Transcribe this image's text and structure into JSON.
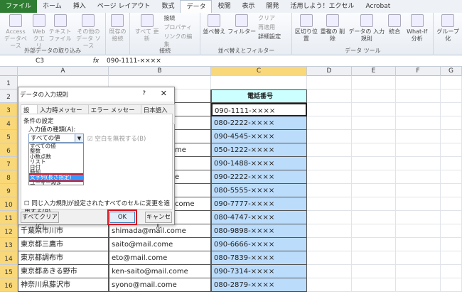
{
  "tabs": [
    "ファイル",
    "ホーム",
    "挿入",
    "ページ レイアウト",
    "数式",
    "データ",
    "校閲",
    "表示",
    "開発",
    "活用しよう！エクセル",
    "Acrobat"
  ],
  "ribbon": {
    "ext": {
      "label": "外部データの取り込み",
      "buttons": [
        "Access データベース",
        "Web クエリ",
        "テキスト ファイル",
        "その他の データ ソース"
      ]
    },
    "conn": {
      "label": "接続",
      "big": "既存の 接続",
      "refresh": "すべて 更新",
      "items": [
        "接続",
        "プロパティ",
        "リンクの編集"
      ]
    },
    "sort": {
      "label": "並べ替えとフィルター",
      "sort": "並べ替え",
      "filter": "フィルター",
      "items": [
        "クリア",
        "再適用",
        "詳細設定"
      ]
    },
    "tools": {
      "label": "データ ツール",
      "buttons": [
        "区切り位置",
        "重複の 削除",
        "データの 入力規則",
        "統合",
        "What-If 分析"
      ]
    },
    "outline": {
      "buttons": [
        "グループ化"
      ]
    }
  },
  "formula": {
    "name": "C3",
    "fx": "fx",
    "value": "090-1111-×××× "
  },
  "columns": [
    "A",
    "B",
    "C",
    "D",
    "E",
    "F",
    "G"
  ],
  "rows": [
    "1",
    "2",
    "3",
    "4",
    "5",
    "6",
    "7",
    "8",
    "9",
    "10",
    "11",
    "12",
    "13",
    "14",
    "15",
    "16"
  ],
  "header_c": "電話番号",
  "phones": [
    "090-1111-××××",
    "080-2222-××××",
    "090-4545-××××",
    "050-1222-××××",
    "090-1488-××××",
    "090-2222-××××",
    "080-5555-××××",
    "090-7777-××××",
    "080-4747-××××",
    "080-9898-××××",
    "090-6666-××××",
    "080-7839-××××",
    "090-7314-××××",
    "080-2879-××××"
  ],
  "b_fragments": {
    "r6": "me",
    "r8": "e",
    "r10": "come"
  },
  "addresses": [
    "千葉県市川市",
    "東京都三鷹市",
    "東京都調布市",
    "東京都あきる野市",
    "神奈川県藤沢市"
  ],
  "emails": [
    "shimada@mail.come",
    "saito@mail.come",
    "eto@mail.come",
    "ken-saito@mail.come",
    "syono@mail.come"
  ],
  "dialog": {
    "title": "データの入力規則",
    "help": "?",
    "close": "✕",
    "tabs": [
      "設定",
      "入力時メッセージ",
      "エラー メッセージ",
      "日本語入力"
    ],
    "section": "条件の設定",
    "type_label": "入力値の種類(A):",
    "selected": "すべての値",
    "ignore_blank": "空白を無視する(B)",
    "options": [
      "すべての値",
      "整数",
      "小数点数",
      "リスト",
      "日付",
      "時刻",
      "文字列(長さ指定)",
      "ユーザー設定"
    ],
    "apply_all": "同じ入力規則が設定されたすべてのセルに変更を適用する(P)",
    "clear": "すべてクリア(C)",
    "ok": "OK",
    "cancel": "キャンセル"
  }
}
